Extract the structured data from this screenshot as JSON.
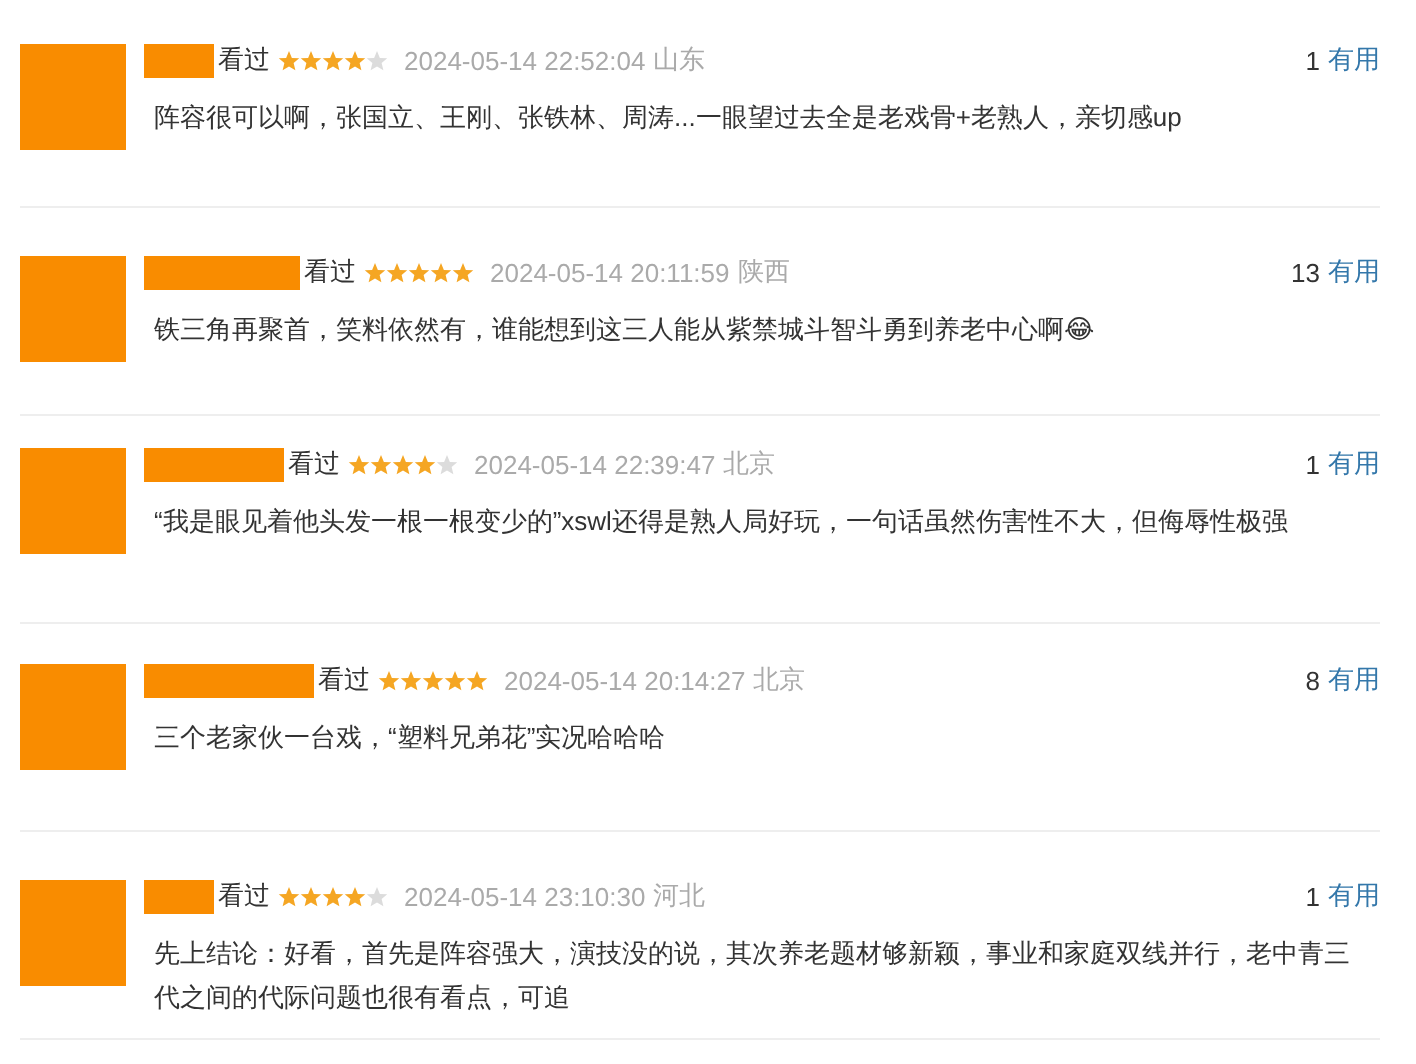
{
  "reviews": [
    {
      "status": "看过",
      "stars": 4,
      "time": "2024-05-14 22:52:04",
      "location": "山东",
      "useful_count": "1",
      "useful_label": "有用",
      "text": "阵容很可以啊，张国立、王刚、张铁林、周涛...一眼望过去全是老戏骨+老熟人，亲切感up"
    },
    {
      "status": "看过",
      "stars": 5,
      "time": "2024-05-14 20:11:59",
      "location": "陕西",
      "useful_count": "13",
      "useful_label": "有用",
      "text": "铁三角再聚首，笑料依然有，谁能想到这三人能从紫禁城斗智斗勇到养老中心啊😂"
    },
    {
      "status": "看过",
      "stars": 4,
      "time": "2024-05-14 22:39:47",
      "location": "北京",
      "useful_count": "1",
      "useful_label": "有用",
      "text": "“我是眼见着他头发一根一根变少的”xswl还得是熟人局好玩，一句话虽然伤害性不大，但侮辱性极强"
    },
    {
      "status": "看过",
      "stars": 5,
      "time": "2024-05-14 20:14:27",
      "location": "北京",
      "useful_count": "8",
      "useful_label": "有用",
      "text": "三个老家伙一台戏，“塑料兄弟花”实况哈哈哈"
    },
    {
      "status": "看过",
      "stars": 4,
      "time": "2024-05-14 23:10:30",
      "location": "河北",
      "useful_count": "1",
      "useful_label": "有用",
      "text": "先上结论：好看，首先是阵容强大，演技没的说，其次养老题材够新颖，事业和家庭双线并行，老中青三代之间的代际问题也很有看点，可追"
    }
  ]
}
